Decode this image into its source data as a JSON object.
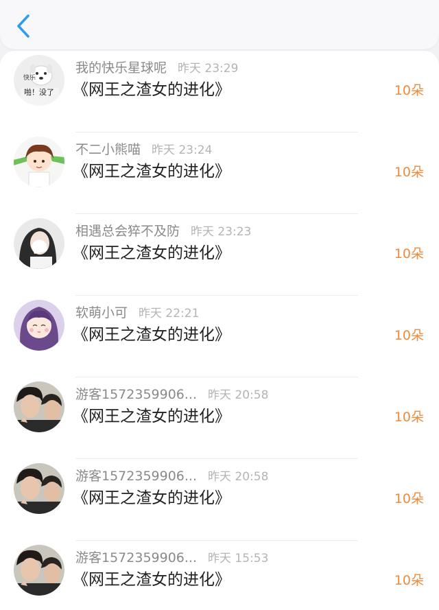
{
  "header": {
    "back_icon": "chevron-left-icon",
    "accent_color": "#2f9cf0"
  },
  "rows": [
    {
      "username": "我的快乐星球呢",
      "time": "昨天 23:29",
      "title": "《网王之渣女的进化》",
      "count": "10朵",
      "avatar": "dog-meme-avatar",
      "avatar_text_1": "快乐",
      "avatar_text_2": "啪！没了"
    },
    {
      "username": "不二小熊喵",
      "time": "昨天 23:24",
      "title": "《网王之渣女的进化》",
      "count": "10朵",
      "avatar": "anime-boy-avatar"
    },
    {
      "username": "相遇总会猝不及防",
      "time": "昨天 23:23",
      "title": "《网王之渣女的进化》",
      "count": "10朵",
      "avatar": "girl-photo-avatar"
    },
    {
      "username": "软萌小可",
      "time": "昨天 22:21",
      "title": "《网王之渣女的进化》",
      "count": "10朵",
      "avatar": "anime-girl-avatar"
    },
    {
      "username": "游客1572359906...",
      "time": "昨天 20:58",
      "title": "《网王之渣女的进化》",
      "count": "10朵",
      "avatar": "two-men-photo-avatar"
    },
    {
      "username": "游客1572359906...",
      "time": "昨天 20:58",
      "title": "《网王之渣女的进化》",
      "count": "10朵",
      "avatar": "two-men-photo-avatar"
    },
    {
      "username": "游客1572359906...",
      "time": "昨天 15:53",
      "title": "《网王之渣女的进化》",
      "count": "10朵",
      "avatar": "two-men-photo-avatar"
    }
  ],
  "colors": {
    "username": "#8a8a8a",
    "timestamp": "#b4b4b4",
    "title": "#222222",
    "count": "#ee8a3c"
  }
}
